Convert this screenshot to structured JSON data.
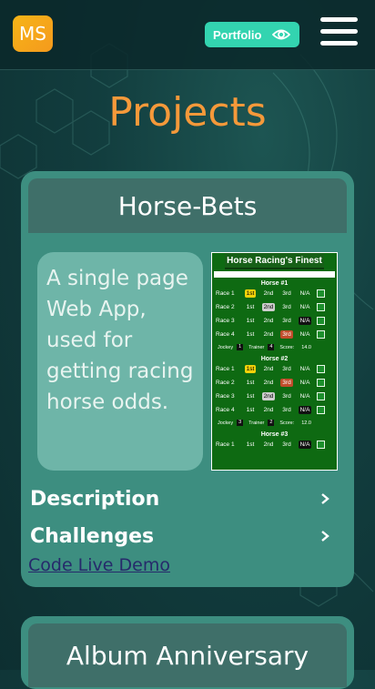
{
  "nav": {
    "logo_text": "MS",
    "portfolio_label": "Portfolio"
  },
  "page": {
    "title": "Projects"
  },
  "project1": {
    "title": "Horse-Bets",
    "description": "A single page Web App, used for getting racing horse odds.",
    "sections": [
      "Description",
      "Challenges"
    ],
    "link_text": "Code Live Demo",
    "thumbnail": {
      "title": "Horse Racing's Finest",
      "horses": [
        {
          "label": "Horse #1",
          "races": [
            {
              "race": "Race 1",
              "picks": [
                "1st",
                "2nd",
                "3rd",
                "N/A"
              ],
              "selected": "1st"
            },
            {
              "race": "Race 2",
              "picks": [
                "1st",
                "2nd",
                "3rd",
                "N/A"
              ],
              "selected": "2nd"
            },
            {
              "race": "Race 3",
              "picks": [
                "1st",
                "2nd",
                "3rd",
                "N/A"
              ],
              "selected": "N/A"
            },
            {
              "race": "Race 4",
              "picks": [
                "1st",
                "2nd",
                "3rd",
                "N/A"
              ],
              "selected": "3rd"
            }
          ],
          "jockey": "1",
          "trainer": "4",
          "score": "14.0"
        },
        {
          "label": "Horse #2",
          "races": [
            {
              "race": "Race 1",
              "picks": [
                "1st",
                "2nd",
                "3rd",
                "N/A"
              ],
              "selected": "1st"
            },
            {
              "race": "Race 2",
              "picks": [
                "1st",
                "2nd",
                "3rd",
                "N/A"
              ],
              "selected": "3rd"
            },
            {
              "race": "Race 3",
              "picks": [
                "1st",
                "2nd",
                "3rd",
                "N/A"
              ],
              "selected": "2nd"
            },
            {
              "race": "Race 4",
              "picks": [
                "1st",
                "2nd",
                "3rd",
                "N/A"
              ],
              "selected": "N/A"
            }
          ],
          "jockey": "3",
          "trainer": "2",
          "score": "12.0"
        },
        {
          "label": "Horse #3",
          "races": [
            {
              "race": "Race 1",
              "picks": [
                "1st",
                "2nd",
                "3rd",
                "N/A"
              ],
              "selected": "N/A"
            }
          ]
        }
      ],
      "jockey_label": "Jockey",
      "trainer_label": "Trainer",
      "score_label": "Score"
    }
  },
  "project2": {
    "title": "Album Anniversary"
  },
  "colors": {
    "accent_orange": "#f5993a",
    "portfolio_green": "#33d4b0",
    "card_teal": "#3d8e80",
    "card_header": "#3f6f69"
  },
  "icons": [
    "eye-icon",
    "menu-icon",
    "chevron-right-icon"
  ]
}
